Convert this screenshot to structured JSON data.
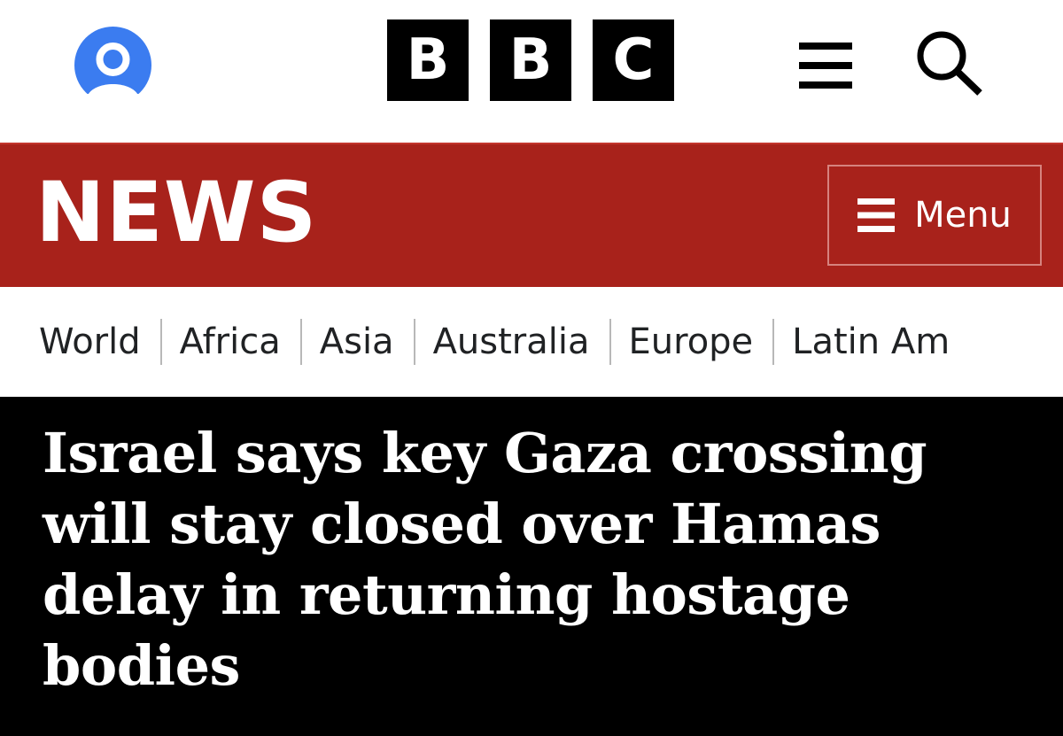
{
  "header": {
    "logo_letters": [
      "B",
      "B",
      "C"
    ],
    "account_icon": "user-icon",
    "menu_icon": "hamburger-icon",
    "search_icon": "search-icon",
    "account_color": "#3b7cf0"
  },
  "banner": {
    "title": "NEWS",
    "menu_label": "Menu",
    "menu_icon": "hamburger-icon",
    "background": "#a8221b"
  },
  "sections": [
    {
      "label": "World"
    },
    {
      "label": "Africa"
    },
    {
      "label": "Asia"
    },
    {
      "label": "Australia"
    },
    {
      "label": "Europe"
    },
    {
      "label": "Latin Am"
    }
  ],
  "article": {
    "headline": "Israel says key Gaza crossing will stay closed over Hamas delay in returning hostage bodies"
  }
}
